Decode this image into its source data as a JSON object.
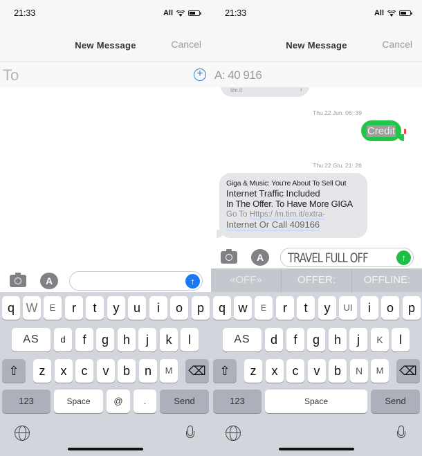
{
  "left": {
    "status": {
      "time": "21:33",
      "carrier": "All"
    },
    "navbar": {
      "title": "New Message",
      "cancel": "Cancel"
    },
    "to_field": {
      "label": "To"
    },
    "input": {
      "value": ""
    },
    "keyboard": {
      "row1": [
        "q",
        "W",
        "E",
        "r",
        "t",
        "y",
        "u",
        "i",
        "o",
        "p"
      ],
      "row2": [
        "AS",
        "d",
        "f",
        "g",
        "h",
        "j",
        "k",
        "l"
      ],
      "row3": [
        "z",
        "x",
        "c",
        "v",
        "b",
        "n",
        "M"
      ],
      "numbers": "123",
      "space": "Space",
      "at": "@",
      "period": ".",
      "send": "Send"
    }
  },
  "right": {
    "status": {
      "time": "21:33",
      "carrier": "All"
    },
    "navbar": {
      "title": "New Message",
      "cancel": "Cancel"
    },
    "to_field": {
      "recipient": "A: 40 916"
    },
    "conversation": {
      "top_bubble_tail": "tim.it",
      "timestamp_1": "Thu 22 Jun. 06: 39",
      "outgoing": "Credit",
      "timestamp_2": "Thu 22 Glu. 21: 26",
      "incoming": {
        "line1": "Giga & Music: You're About To Sell Out",
        "line2": "Internet Traffic Included",
        "line3": "In The Offer. To Have More GIGA",
        "line4_prefix": "Go To ",
        "line4_url": "Https:/ /m.tim.it/extra-",
        "line5": "Internet Or Call 409166"
      }
    },
    "input": {
      "value": "TRAVEL FULL OFF"
    },
    "suggestions": [
      "«OFF»",
      "OFFER:",
      "OFFLINE:"
    ],
    "keyboard": {
      "row1": [
        "q",
        "w",
        "E",
        "r",
        "t",
        "y",
        "UI",
        "i",
        "o",
        "p"
      ],
      "row2": [
        "AS",
        "d",
        "f",
        "g",
        "h",
        "j",
        "K",
        "l"
      ],
      "row3": [
        "z",
        "x",
        "c",
        "v",
        "b",
        "N",
        "M"
      ],
      "numbers": "123",
      "space": "Space",
      "send": "Send"
    }
  }
}
